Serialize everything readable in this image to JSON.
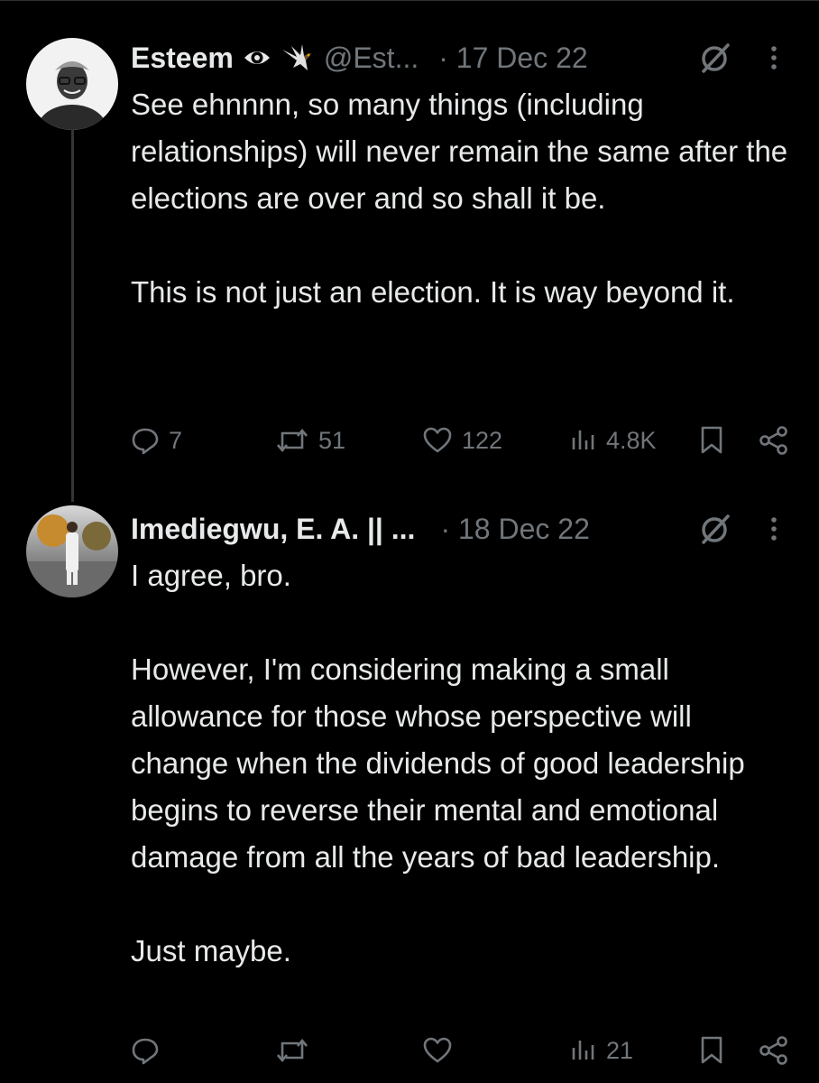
{
  "colors": {
    "background": "#000000",
    "text": "#e7e9ea",
    "muted": "#71767b",
    "divider": "#2f3336"
  },
  "tweets": [
    {
      "name": "Esteem",
      "badges": [
        "eye-icon",
        "eagle-icon"
      ],
      "handle": "@Est...",
      "date": "· 17 Dec 22",
      "text": "See ehnnnn, so many things (including relationships) will never remain the same after the elections are over and so shall it be.\n\nThis is not just an election. It is way beyond it.",
      "stats": {
        "replies": "7",
        "retweets": "51",
        "likes": "122",
        "views": "4.8K"
      }
    },
    {
      "name": "Imediegwu, E. A. || ...",
      "badges": [],
      "handle": "",
      "date": "· 18 Dec 22",
      "text": "I agree, bro.\n\nHowever, I'm considering making a small allowance for those whose perspective will change when the dividends of good leadership begins to reverse their mental and emotional damage from all the years of bad leadership.\n\nJust maybe.",
      "stats": {
        "replies": "",
        "retweets": "",
        "likes": "",
        "views": "21"
      }
    }
  ]
}
